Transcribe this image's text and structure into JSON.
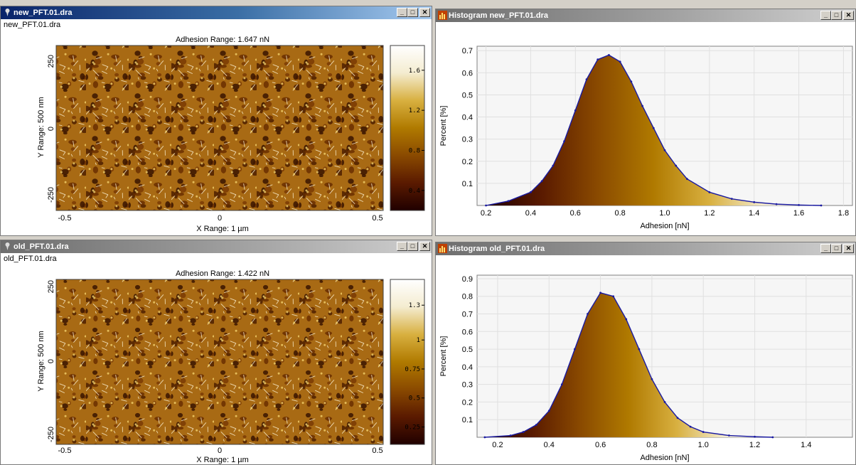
{
  "windows": {
    "map_top": {
      "title": "new_PFT.01.dra",
      "file_label": "new_PFT.01.dra",
      "range_title": "Adhesion Range:  1.647 nN",
      "y_label": "Y Range: 500 nm",
      "x_label": "X Range: 1 µm",
      "y_ticks": [
        "250",
        "0",
        "-250"
      ],
      "x_ticks": [
        "-0.5",
        "0",
        "0.5"
      ],
      "colorbar_ticks": [
        {
          "label": "1.6",
          "value": 1.6
        },
        {
          "label": "1.2",
          "value": 1.2
        },
        {
          "label": "0.8",
          "value": 0.8
        },
        {
          "label": "0.4",
          "value": 0.4
        }
      ],
      "colorbar_range": [
        0.2,
        1.847
      ]
    },
    "map_bottom": {
      "title": "old_PFT.01.dra",
      "file_label": "old_PFT.01.dra",
      "range_title": "Adhesion Range:  1.422 nN",
      "y_label": "Y Range: 500 nm",
      "x_label": "X Range: 1 µm",
      "y_ticks": [
        "250",
        "0",
        "-250"
      ],
      "x_ticks": [
        "-0.5",
        "0",
        "0.5"
      ],
      "colorbar_ticks": [
        {
          "label": "1.3",
          "value": 1.3
        },
        {
          "label": "1",
          "value": 1.0
        },
        {
          "label": "0.75",
          "value": 0.75
        },
        {
          "label": "0.5",
          "value": 0.5
        },
        {
          "label": "0.25",
          "value": 0.25
        }
      ],
      "colorbar_range": [
        0.1,
        1.522
      ]
    },
    "hist_top": {
      "title": "Histogram new_PFT.01.dra"
    },
    "hist_bottom": {
      "title": "Histogram old_PFT.01.dra"
    }
  },
  "window_buttons": {
    "minimize": "_",
    "maximize": "□",
    "close": "✕"
  },
  "colors": {
    "titlebar_active": "#0a246a",
    "histogram_outline": "#1a1aa0",
    "colormap": [
      "#200000",
      "#5a1a00",
      "#8a4a00",
      "#b07a00",
      "#d8b040",
      "#f4ecd0",
      "#ffffff"
    ]
  },
  "chart_data": [
    {
      "type": "area",
      "title": "",
      "xlabel": "Adhesion [nN]",
      "ylabel": "Percent [%]",
      "xlim": [
        0.16,
        1.84
      ],
      "ylim": [
        0,
        0.72
      ],
      "x_ticks": [
        0.2,
        0.4,
        0.6,
        0.8,
        1.0,
        1.2,
        1.4,
        1.6,
        1.8
      ],
      "x_tick_labels": [
        "0.2",
        "0.4",
        "0.6",
        "0.8",
        "1.0",
        "1.2",
        "1.4",
        "1.6",
        "1.8"
      ],
      "y_ticks": [
        0.1,
        0.2,
        0.3,
        0.4,
        0.5,
        0.6,
        0.7
      ],
      "y_tick_labels": [
        "0.1",
        "0.2",
        "0.3",
        "0.4",
        "0.5",
        "0.6",
        "0.7"
      ],
      "grid": true,
      "x": [
        0.2,
        0.3,
        0.4,
        0.45,
        0.5,
        0.55,
        0.6,
        0.65,
        0.7,
        0.75,
        0.8,
        0.85,
        0.9,
        0.95,
        1.0,
        1.05,
        1.1,
        1.2,
        1.3,
        1.4,
        1.5,
        1.6,
        1.7
      ],
      "y": [
        0.0,
        0.02,
        0.06,
        0.11,
        0.18,
        0.29,
        0.43,
        0.57,
        0.66,
        0.68,
        0.65,
        0.56,
        0.45,
        0.35,
        0.25,
        0.18,
        0.12,
        0.06,
        0.03,
        0.015,
        0.006,
        0.002,
        0.0
      ]
    },
    {
      "type": "area",
      "title": "",
      "xlabel": "Adhesion [nN]",
      "ylabel": "Percent [%]",
      "xlim": [
        0.12,
        1.58
      ],
      "ylim": [
        0,
        0.92
      ],
      "x_ticks": [
        0.2,
        0.4,
        0.6,
        0.8,
        1.0,
        1.2,
        1.4
      ],
      "x_tick_labels": [
        "0.2",
        "0.4",
        "0.6",
        "0.8",
        "1.0",
        "1.2",
        "1.4"
      ],
      "y_ticks": [
        0.1,
        0.2,
        0.3,
        0.4,
        0.5,
        0.6,
        0.7,
        0.8,
        0.9
      ],
      "y_tick_labels": [
        "0.1",
        "0.2",
        "0.3",
        "0.4",
        "0.5",
        "0.6",
        "0.7",
        "0.8",
        "0.9"
      ],
      "grid": true,
      "x": [
        0.15,
        0.25,
        0.3,
        0.35,
        0.4,
        0.45,
        0.5,
        0.55,
        0.6,
        0.65,
        0.7,
        0.75,
        0.8,
        0.85,
        0.9,
        0.95,
        1.0,
        1.1,
        1.2,
        1.27
      ],
      "y": [
        0.0,
        0.01,
        0.03,
        0.07,
        0.15,
        0.3,
        0.5,
        0.7,
        0.82,
        0.8,
        0.67,
        0.5,
        0.33,
        0.2,
        0.11,
        0.06,
        0.03,
        0.01,
        0.003,
        0.0
      ]
    }
  ]
}
